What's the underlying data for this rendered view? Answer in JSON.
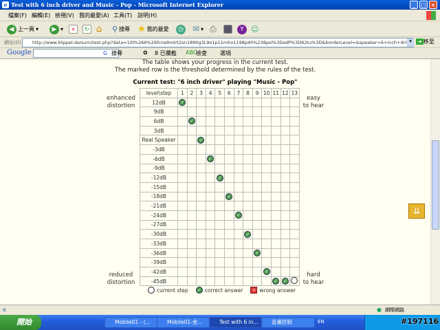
{
  "window": {
    "title": "Test with 6 inch driver and Music - Pop - Microsoft Internet Explorer"
  },
  "menu": [
    "檔案(F)",
    "編輯(E)",
    "檢視(V)",
    "我的最愛(A)",
    "工具(T)",
    "說明(H)"
  ],
  "toolbar": {
    "back": "上一頁",
    "search": "搜尋",
    "favorites": "我的最愛"
  },
  "address": {
    "label": "網址(D)",
    "url": "http://www.klippel.de/sum/test.php?data=1ilt%266%26fcne9mtrt2sn1890g3L9o1p11mho1198p40%238psi%3DsdP%3D62tu%3D&borderLevel=&speaker=6+inch+driver&music=Music+-",
    "go": "移至"
  },
  "google": {
    "logo": "Google",
    "search": "搜尋",
    "blocked": "8 已攔截",
    "check": "檢查",
    "options": "選項"
  },
  "page": {
    "intro1": "The table shows your progress in the current test.",
    "intro2": "The marked row is the threshold determined by the rules of the test.",
    "test_title": "Current test: \"6 inch driver\" playing \"Music - Pop\"",
    "corner": "level\\step",
    "steps": [
      "1",
      "2",
      "3",
      "4",
      "5",
      "6",
      "7",
      "8",
      "9",
      "10",
      "11",
      "12",
      "13"
    ],
    "levels": [
      "12dB",
      "9dB",
      "6dB",
      "3dB",
      "Real Speaker",
      "-3dB",
      "-6dB",
      "-9dB",
      "-12dB",
      "-15dB",
      "-18dB",
      "-21dB",
      "-24dB",
      "-27dB",
      "-30dB",
      "-33dB",
      "-36dB",
      "-39dB",
      "-42dB",
      "-45dB"
    ],
    "marks": [
      {
        "level": "12dB",
        "step": 1,
        "state": "correct"
      },
      {
        "level": "6dB",
        "step": 2,
        "state": "correct"
      },
      {
        "level": "Real Speaker",
        "step": 3,
        "state": "correct"
      },
      {
        "level": "-6dB",
        "step": 4,
        "state": "correct"
      },
      {
        "level": "-12dB",
        "step": 5,
        "state": "correct"
      },
      {
        "level": "-18dB",
        "step": 6,
        "state": "correct"
      },
      {
        "level": "-24dB",
        "step": 7,
        "state": "correct"
      },
      {
        "level": "-30dB",
        "step": 8,
        "state": "correct"
      },
      {
        "level": "-36dB",
        "step": 9,
        "state": "correct"
      },
      {
        "level": "-42dB",
        "step": 10,
        "state": "correct"
      },
      {
        "level": "-45dB",
        "step": 11,
        "state": "correct"
      },
      {
        "level": "-45dB",
        "step": 12,
        "state": "correct"
      },
      {
        "level": "-45dB",
        "step": 13,
        "state": "current"
      }
    ],
    "top_left": "enhanced\ndistortion",
    "top_right": "easy\nto hear",
    "bottom_left": "reduced\ndistortion",
    "bottom_right": "hard\nto hear",
    "legend": {
      "current": "current step",
      "correct": "correct answer",
      "wrong": "wrong answer"
    }
  },
  "status": {
    "zone": "網際網路"
  },
  "taskbar": {
    "start": "開始",
    "tasks": [
      "Mobile01 - (...",
      "Mobile01-金...",
      "Test with 6 in...",
      "音量控制"
    ],
    "lang": "EN",
    "watermark": "#197116"
  }
}
